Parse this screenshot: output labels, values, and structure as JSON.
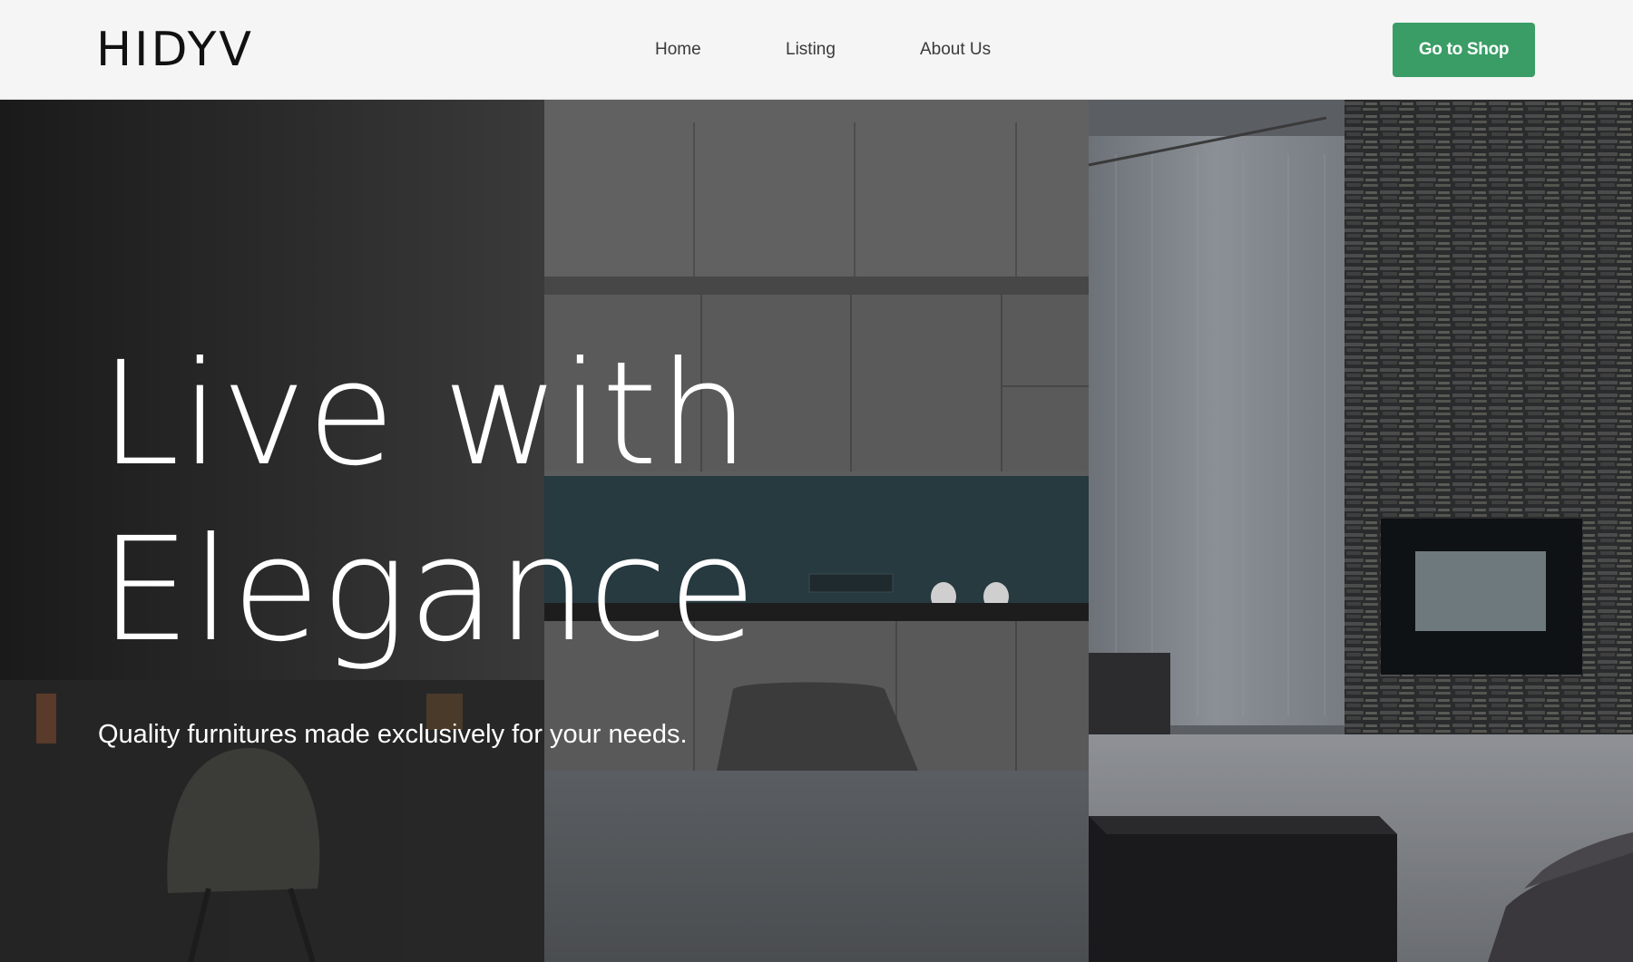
{
  "header": {
    "logo": "HIDYV",
    "nav": [
      "Home",
      "Listing",
      "About Us"
    ],
    "cta_label": "Go to Shop"
  },
  "hero": {
    "headline_line1": "Live with",
    "headline_line2": "Elegance",
    "tagline": "Quality furnitures made exclusively for your needs."
  },
  "colors": {
    "accent": "#3a9d66",
    "header_bg": "#f5f5f5",
    "hero_text": "#ffffff"
  },
  "icons": {
    "logo": "wordmark"
  }
}
